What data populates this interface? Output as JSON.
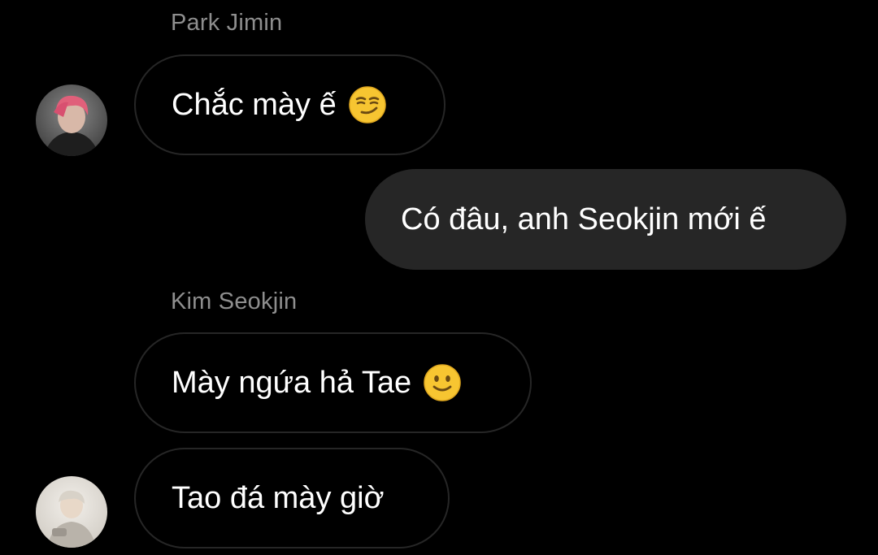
{
  "messages": [
    {
      "sender": "Park Jimin",
      "text": "Chắc mày ế",
      "emoji": "smirking-face-icon",
      "direction": "incoming"
    },
    {
      "text": "Có đâu, anh Seokjin mới ế",
      "direction": "outgoing"
    },
    {
      "sender": "Kim Seokjin",
      "text": "Mày ngứa hả Tae",
      "emoji": "slightly-smiling-face-icon",
      "direction": "incoming"
    },
    {
      "text": "Tao đá mày giờ",
      "direction": "incoming"
    }
  ],
  "colors": {
    "background": "#000000",
    "incoming_border": "#262626",
    "outgoing_bubble": "#262626",
    "sender_name": "#8e8e8e",
    "text": "#ffffff",
    "emoji_yellow": "#f7c531"
  }
}
